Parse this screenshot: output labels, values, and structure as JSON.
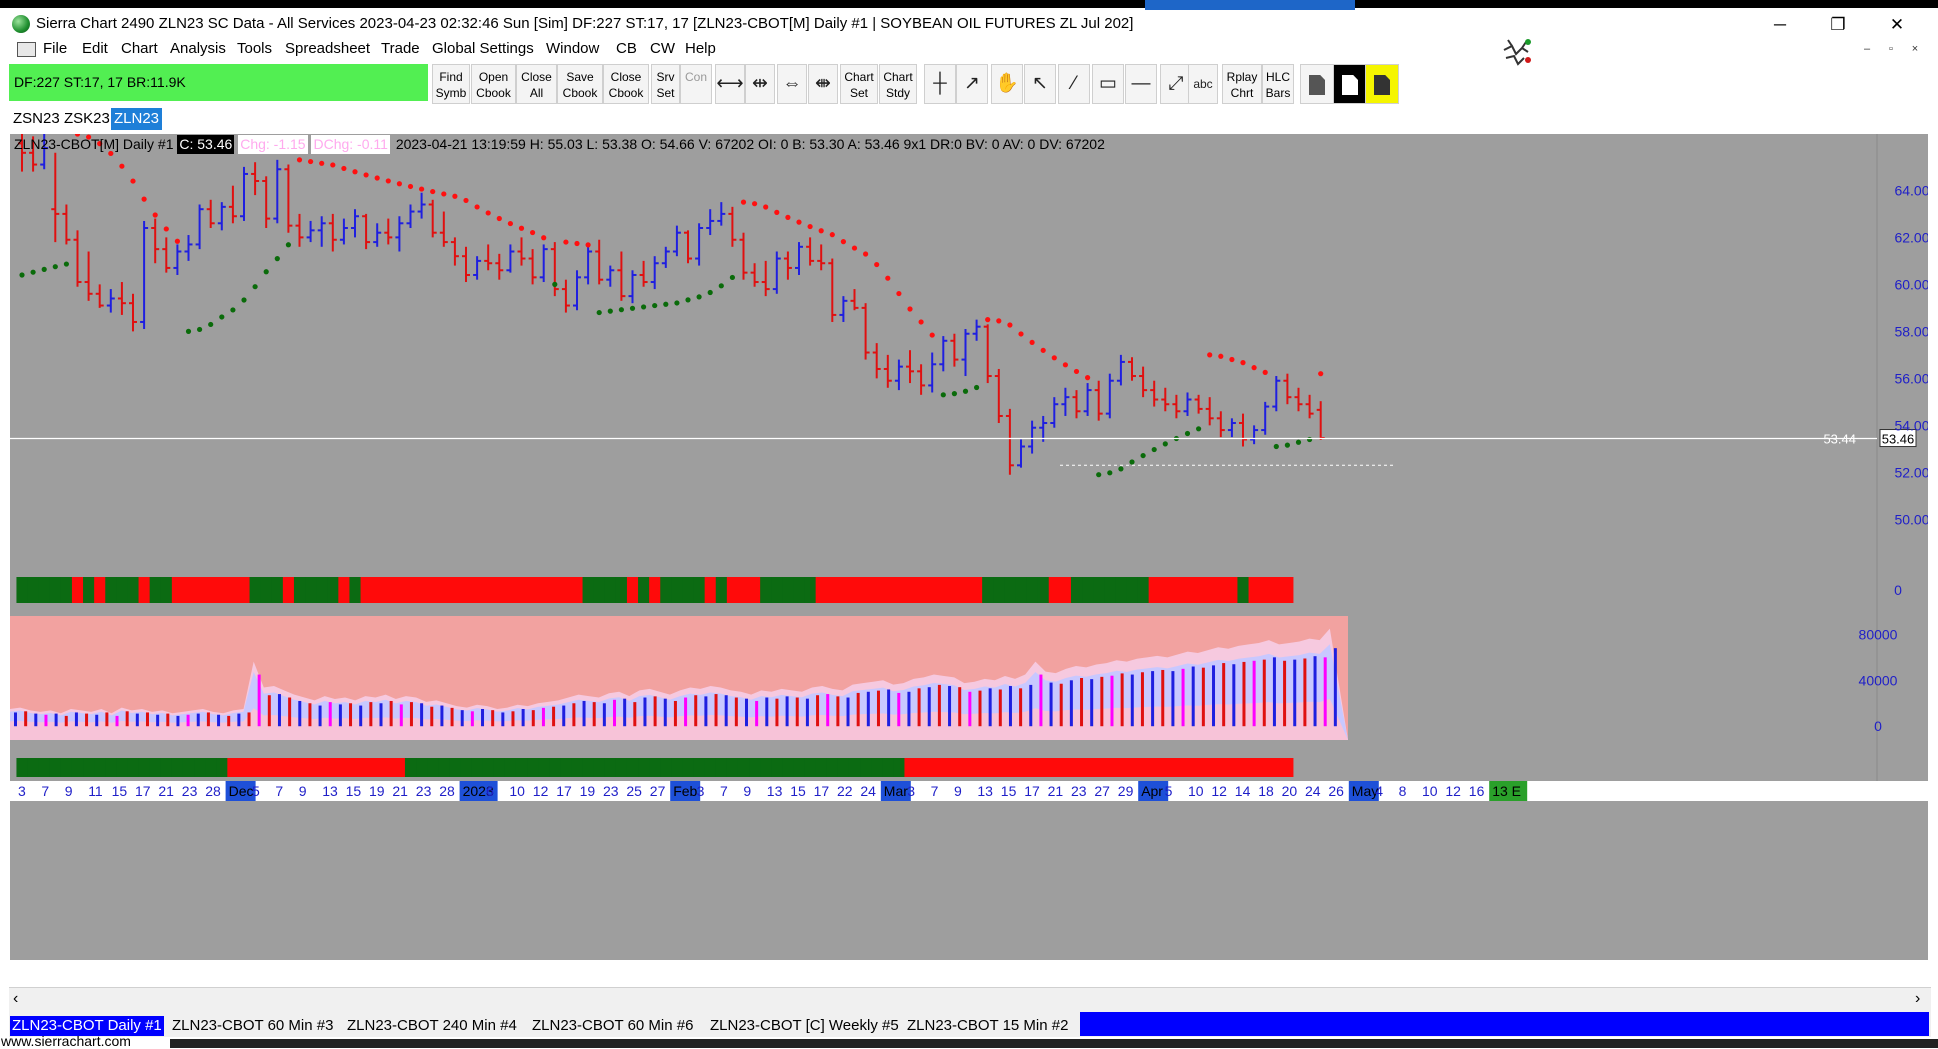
{
  "window": {
    "title": "Sierra Chart 2490 ZLN23  SC Data - All Services 2023-04-23  02:32:46 Sun [Sim]   DF:227  ST:17, 17  [ZLN23-CBOT[M]  Daily  #1 | SOYBEAN OIL FUTURES ZL Jul 202]",
    "minimize": "─",
    "restore": "❐",
    "close": "✕",
    "mdi_minimize": "‒",
    "mdi_restore": "▫",
    "mdi_close": "×"
  },
  "menu": [
    "File",
    "Edit",
    "Chart",
    "Analysis",
    "Tools",
    "Spreadsheet",
    "Trade",
    "Global Settings",
    "Window",
    "CB",
    "CW",
    "Help"
  ],
  "status_box": "DF:227  ST:17, 17  BR:11.9K",
  "toolbar": {
    "text_buttons": [
      {
        "line1": "Find",
        "line2": "Symb"
      },
      {
        "line1": "Open",
        "line2": "Cbook"
      },
      {
        "line1": "Close",
        "line2": "All"
      },
      {
        "line1": "Save",
        "line2": "Cbook"
      },
      {
        "line1": "Close",
        "line2": "Cbook"
      },
      {
        "line1": "Srv",
        "line2": "Set"
      },
      {
        "line1": "Con",
        "line2": ""
      }
    ],
    "chart_buttons": [
      {
        "line1": "Chart",
        "line2": "Set"
      },
      {
        "line1": "Chart",
        "line2": "Stdy"
      }
    ],
    "replay": {
      "line1": "Rplay",
      "line2": "Chrt"
    },
    "hlc": {
      "line1": "HLC",
      "line2": "Bars"
    },
    "abc": "abc",
    "glyphs": [
      "⟷",
      "⇹",
      "⇔",
      "⇼",
      "┼",
      "↗",
      "✋",
      "↖",
      "⁄",
      "▭",
      "—",
      "⤢"
    ]
  },
  "symbol_tabs": [
    "ZSN23",
    "ZSK23",
    "ZLN23"
  ],
  "active_symbol_tab": 2,
  "info": {
    "symbol": "ZLN23-CBOT[M]  Daily  #1",
    "close": "C: 53.46",
    "chg": "Chg: -1.15",
    "dchg": "DChg: -0.11",
    "details": "2023-04-21 13:19:59 H: 55.03  L: 53.38  O: 54.66  V: 67202  OI: 0  B: 53.30  A: 53.46  9x1  DR:0  BV: 0  AV: 0  DV: 67202"
  },
  "price_labels": {
    "line": "53.44",
    "last": "53.46"
  },
  "colors": {
    "chart_bg": "#9e9e9e",
    "up_bar": "#1f1fe0",
    "down_bar": "#e01010",
    "psar_down": "#ff1010",
    "psar_up": "#0a6b0a",
    "psar_neutral": "#7d7d7d",
    "band_green": "#0b6b12",
    "band_red": "#ff0a0a",
    "vol_bg": "#f2a2a0",
    "vol_base": "#f7c3d8",
    "vol_band": "#c8c8ff",
    "axis_text": "#1f1fc8",
    "date_highlight": "#1e50d8"
  },
  "chart_data": {
    "type": "candlestick",
    "title": "ZLN23-CBOT[M] Daily",
    "y_axis_labels": [
      "64.00",
      "62.00",
      "60.00",
      "58.00",
      "56.00",
      "54.00",
      "52.00",
      "50.00"
    ],
    "ylim": [
      48.1,
      66.4
    ],
    "x_axis_labels": [
      "3",
      "7",
      "9",
      "11",
      "15",
      "17",
      "21",
      "23",
      "28",
      "Dec",
      "5",
      "7",
      "9",
      "13",
      "15",
      "19",
      "21",
      "23",
      "28",
      "2023",
      "6",
      "10",
      "12",
      "17",
      "19",
      "23",
      "25",
      "27",
      "Feb",
      "3",
      "7",
      "9",
      "13",
      "15",
      "17",
      "22",
      "24",
      "Mar",
      "3",
      "7",
      "9",
      "13",
      "15",
      "17",
      "21",
      "23",
      "27",
      "29",
      "Apr",
      "5",
      "10",
      "12",
      "14",
      "18",
      "20",
      "24",
      "26",
      "May",
      "4",
      "8",
      "10",
      "12",
      "16",
      "13 E"
    ],
    "highlighted_x_labels": [
      "Dec",
      "2023",
      "Feb",
      "Mar",
      "Apr",
      "May"
    ],
    "last_x_label": "13 E",
    "bars": [
      {
        "o": 66.0,
        "h": 66.4,
        "l": 64.8,
        "c": 65.6
      },
      {
        "o": 65.6,
        "h": 66.3,
        "l": 64.8,
        "c": 65.1
      },
      {
        "o": 65.1,
        "h": 66.4,
        "l": 64.9,
        "c": 65.8
      },
      {
        "o": 63.2,
        "h": 65.6,
        "l": 61.8,
        "c": 63.0
      },
      {
        "o": 63.0,
        "h": 63.4,
        "l": 61.7,
        "c": 61.9
      },
      {
        "o": 61.9,
        "h": 62.3,
        "l": 59.9,
        "c": 60.1
      },
      {
        "o": 60.1,
        "h": 61.4,
        "l": 59.3,
        "c": 59.6
      },
      {
        "o": 59.6,
        "h": 60.0,
        "l": 59.0,
        "c": 59.1
      },
      {
        "o": 59.1,
        "h": 59.8,
        "l": 58.8,
        "c": 59.4
      },
      {
        "o": 59.4,
        "h": 60.1,
        "l": 58.7,
        "c": 59.2
      },
      {
        "o": 59.2,
        "h": 59.6,
        "l": 58.0,
        "c": 58.4
      },
      {
        "o": 58.4,
        "h": 62.7,
        "l": 58.1,
        "c": 62.4
      },
      {
        "o": 62.4,
        "h": 62.8,
        "l": 60.9,
        "c": 61.5
      },
      {
        "o": 61.5,
        "h": 62.0,
        "l": 60.5,
        "c": 60.7
      },
      {
        "o": 60.7,
        "h": 61.7,
        "l": 60.4,
        "c": 61.4
      },
      {
        "o": 61.4,
        "h": 62.1,
        "l": 61.0,
        "c": 61.7
      },
      {
        "o": 61.7,
        "h": 63.4,
        "l": 61.5,
        "c": 63.2
      },
      {
        "o": 63.2,
        "h": 63.6,
        "l": 62.4,
        "c": 62.6
      },
      {
        "o": 62.6,
        "h": 63.5,
        "l": 62.3,
        "c": 63.3
      },
      {
        "o": 63.3,
        "h": 64.2,
        "l": 62.6,
        "c": 62.9
      },
      {
        "o": 62.9,
        "h": 65.0,
        "l": 62.7,
        "c": 64.7
      },
      {
        "o": 64.7,
        "h": 65.2,
        "l": 63.8,
        "c": 64.4
      },
      {
        "o": 64.4,
        "h": 64.6,
        "l": 62.4,
        "c": 62.8
      },
      {
        "o": 62.8,
        "h": 65.3,
        "l": 62.6,
        "c": 64.9
      },
      {
        "o": 64.9,
        "h": 65.1,
        "l": 62.2,
        "c": 62.5
      },
      {
        "o": 62.5,
        "h": 63.0,
        "l": 61.6,
        "c": 62.0
      },
      {
        "o": 62.0,
        "h": 62.7,
        "l": 61.8,
        "c": 62.3
      },
      {
        "o": 62.3,
        "h": 62.9,
        "l": 61.6,
        "c": 62.6
      },
      {
        "o": 62.6,
        "h": 63.0,
        "l": 61.4,
        "c": 61.9
      },
      {
        "o": 61.9,
        "h": 62.8,
        "l": 61.7,
        "c": 62.4
      },
      {
        "o": 62.4,
        "h": 63.2,
        "l": 62.0,
        "c": 62.9
      },
      {
        "o": 62.9,
        "h": 63.0,
        "l": 61.5,
        "c": 61.8
      },
      {
        "o": 61.8,
        "h": 62.6,
        "l": 61.6,
        "c": 62.2
      },
      {
        "o": 62.2,
        "h": 62.8,
        "l": 61.7,
        "c": 62.0
      },
      {
        "o": 62.0,
        "h": 62.9,
        "l": 61.4,
        "c": 62.6
      },
      {
        "o": 62.6,
        "h": 63.4,
        "l": 62.4,
        "c": 63.1
      },
      {
        "o": 63.1,
        "h": 63.9,
        "l": 62.8,
        "c": 63.4
      },
      {
        "o": 63.4,
        "h": 63.6,
        "l": 62.0,
        "c": 62.2
      },
      {
        "o": 62.2,
        "h": 63.1,
        "l": 61.6,
        "c": 61.8
      },
      {
        "o": 61.8,
        "h": 62.0,
        "l": 60.8,
        "c": 61.2
      },
      {
        "o": 61.2,
        "h": 61.6,
        "l": 60.1,
        "c": 60.4
      },
      {
        "o": 60.4,
        "h": 61.2,
        "l": 60.2,
        "c": 61.0
      },
      {
        "o": 61.0,
        "h": 61.7,
        "l": 60.6,
        "c": 60.9
      },
      {
        "o": 60.9,
        "h": 61.3,
        "l": 60.2,
        "c": 60.6
      },
      {
        "o": 60.6,
        "h": 61.7,
        "l": 60.5,
        "c": 61.4
      },
      {
        "o": 61.4,
        "h": 62.0,
        "l": 60.8,
        "c": 61.1
      },
      {
        "o": 61.1,
        "h": 61.5,
        "l": 60.0,
        "c": 60.3
      },
      {
        "o": 60.3,
        "h": 61.7,
        "l": 60.1,
        "c": 61.5
      },
      {
        "o": 61.5,
        "h": 61.8,
        "l": 59.5,
        "c": 59.8
      },
      {
        "o": 59.8,
        "h": 60.2,
        "l": 58.8,
        "c": 59.1
      },
      {
        "o": 59.1,
        "h": 60.6,
        "l": 58.9,
        "c": 60.3
      },
      {
        "o": 60.3,
        "h": 61.6,
        "l": 60.0,
        "c": 61.4
      },
      {
        "o": 61.4,
        "h": 61.9,
        "l": 60.0,
        "c": 60.2
      },
      {
        "o": 60.2,
        "h": 60.8,
        "l": 59.9,
        "c": 60.6
      },
      {
        "o": 60.6,
        "h": 61.4,
        "l": 59.3,
        "c": 59.5
      },
      {
        "o": 59.5,
        "h": 60.6,
        "l": 59.2,
        "c": 60.4
      },
      {
        "o": 60.4,
        "h": 61.0,
        "l": 59.9,
        "c": 60.1
      },
      {
        "o": 60.1,
        "h": 61.2,
        "l": 59.8,
        "c": 60.9
      },
      {
        "o": 60.9,
        "h": 61.6,
        "l": 60.7,
        "c": 61.4
      },
      {
        "o": 61.4,
        "h": 62.5,
        "l": 61.2,
        "c": 62.2
      },
      {
        "o": 62.2,
        "h": 62.3,
        "l": 60.9,
        "c": 61.1
      },
      {
        "o": 61.1,
        "h": 62.6,
        "l": 60.8,
        "c": 62.4
      },
      {
        "o": 62.4,
        "h": 63.2,
        "l": 62.1,
        "c": 62.7
      },
      {
        "o": 62.7,
        "h": 63.5,
        "l": 62.5,
        "c": 63.0
      },
      {
        "o": 63.0,
        "h": 63.3,
        "l": 61.6,
        "c": 61.9
      },
      {
        "o": 61.9,
        "h": 62.2,
        "l": 60.2,
        "c": 60.5
      },
      {
        "o": 60.5,
        "h": 60.9,
        "l": 59.9,
        "c": 60.1
      },
      {
        "o": 60.1,
        "h": 61.0,
        "l": 59.5,
        "c": 59.8
      },
      {
        "o": 59.8,
        "h": 61.4,
        "l": 59.6,
        "c": 61.1
      },
      {
        "o": 61.1,
        "h": 61.4,
        "l": 60.2,
        "c": 60.7
      },
      {
        "o": 60.7,
        "h": 61.8,
        "l": 60.4,
        "c": 61.6
      },
      {
        "o": 61.6,
        "h": 62.0,
        "l": 60.8,
        "c": 61.0
      },
      {
        "o": 61.0,
        "h": 61.7,
        "l": 60.6,
        "c": 60.9
      },
      {
        "o": 60.9,
        "h": 61.1,
        "l": 58.4,
        "c": 58.7
      },
      {
        "o": 58.7,
        "h": 59.5,
        "l": 58.4,
        "c": 59.3
      },
      {
        "o": 59.3,
        "h": 59.8,
        "l": 58.9,
        "c": 59.0
      },
      {
        "o": 59.0,
        "h": 59.2,
        "l": 56.8,
        "c": 57.1
      },
      {
        "o": 57.1,
        "h": 57.5,
        "l": 56.0,
        "c": 56.4
      },
      {
        "o": 56.4,
        "h": 57.0,
        "l": 55.6,
        "c": 55.9
      },
      {
        "o": 55.9,
        "h": 56.8,
        "l": 55.5,
        "c": 56.5
      },
      {
        "o": 56.5,
        "h": 57.2,
        "l": 55.8,
        "c": 56.3
      },
      {
        "o": 56.3,
        "h": 56.6,
        "l": 55.3,
        "c": 55.7
      },
      {
        "o": 55.7,
        "h": 57.1,
        "l": 55.4,
        "c": 56.6
      },
      {
        "o": 56.6,
        "h": 57.8,
        "l": 56.3,
        "c": 57.6
      },
      {
        "o": 57.6,
        "h": 57.9,
        "l": 56.5,
        "c": 56.8
      },
      {
        "o": 56.8,
        "h": 58.1,
        "l": 56.1,
        "c": 57.9
      },
      {
        "o": 57.9,
        "h": 58.5,
        "l": 57.6,
        "c": 58.2
      },
      {
        "o": 58.2,
        "h": 58.3,
        "l": 55.8,
        "c": 56.1
      },
      {
        "o": 56.1,
        "h": 56.4,
        "l": 54.1,
        "c": 54.4
      },
      {
        "o": 54.4,
        "h": 54.7,
        "l": 51.9,
        "c": 52.3
      },
      {
        "o": 52.3,
        "h": 53.4,
        "l": 52.2,
        "c": 53.1
      },
      {
        "o": 53.1,
        "h": 54.2,
        "l": 52.8,
        "c": 53.9
      },
      {
        "o": 53.9,
        "h": 54.4,
        "l": 53.3,
        "c": 54.1
      },
      {
        "o": 54.1,
        "h": 55.2,
        "l": 53.9,
        "c": 54.9
      },
      {
        "o": 54.9,
        "h": 55.6,
        "l": 54.4,
        "c": 55.2
      },
      {
        "o": 55.2,
        "h": 55.5,
        "l": 54.3,
        "c": 54.6
      },
      {
        "o": 54.6,
        "h": 55.8,
        "l": 54.4,
        "c": 55.5
      },
      {
        "o": 55.5,
        "h": 55.9,
        "l": 54.2,
        "c": 54.5
      },
      {
        "o": 54.5,
        "h": 56.2,
        "l": 54.3,
        "c": 55.9
      },
      {
        "o": 55.9,
        "h": 57.0,
        "l": 55.7,
        "c": 56.7
      },
      {
        "o": 56.7,
        "h": 56.9,
        "l": 55.9,
        "c": 56.1
      },
      {
        "o": 56.1,
        "h": 56.5,
        "l": 55.2,
        "c": 55.5
      },
      {
        "o": 55.5,
        "h": 55.9,
        "l": 54.8,
        "c": 55.1
      },
      {
        "o": 55.1,
        "h": 55.6,
        "l": 54.6,
        "c": 54.9
      },
      {
        "o": 54.9,
        "h": 55.3,
        "l": 54.3,
        "c": 54.6
      },
      {
        "o": 54.6,
        "h": 55.4,
        "l": 54.4,
        "c": 55.1
      },
      {
        "o": 55.1,
        "h": 55.3,
        "l": 54.5,
        "c": 54.7
      },
      {
        "o": 54.7,
        "h": 55.2,
        "l": 54.0,
        "c": 54.3
      },
      {
        "o": 54.3,
        "h": 54.6,
        "l": 53.5,
        "c": 53.8
      },
      {
        "o": 53.8,
        "h": 54.3,
        "l": 53.5,
        "c": 54.1
      },
      {
        "o": 54.1,
        "h": 54.5,
        "l": 53.1,
        "c": 53.4
      },
      {
        "o": 53.4,
        "h": 54.0,
        "l": 53.2,
        "c": 53.8
      },
      {
        "o": 53.8,
        "h": 55.0,
        "l": 53.6,
        "c": 54.8
      },
      {
        "o": 54.8,
        "h": 56.1,
        "l": 54.6,
        "c": 55.9
      },
      {
        "o": 55.9,
        "h": 56.2,
        "l": 54.9,
        "c": 55.2
      },
      {
        "o": 55.2,
        "h": 55.6,
        "l": 54.6,
        "c": 54.9
      },
      {
        "o": 54.9,
        "h": 55.3,
        "l": 54.3,
        "c": 54.5
      },
      {
        "o": 54.66,
        "h": 55.03,
        "l": 53.38,
        "c": 53.46
      }
    ],
    "psar": {
      "start": 0,
      "end": 116,
      "values_start": 60.4,
      "notes": "stop-and-reverse dots"
    },
    "band_top": [
      "g",
      "g",
      "g",
      "g",
      "g",
      "r",
      "g",
      "r",
      "g",
      "g",
      "g",
      "r",
      "g",
      "g",
      "r",
      "r",
      "r",
      "r",
      "r",
      "r",
      "r",
      "g",
      "g",
      "g",
      "r",
      "g",
      "g",
      "g",
      "g",
      "r",
      "g",
      "r",
      "r",
      "r",
      "r",
      "r",
      "r",
      "r",
      "r",
      "r",
      "r",
      "r",
      "r",
      "r",
      "r",
      "r",
      "r",
      "r",
      "r",
      "r",
      "r",
      "g",
      "g",
      "g",
      "g",
      "r",
      "g",
      "r",
      "g",
      "g",
      "g",
      "g",
      "r",
      "g",
      "r",
      "r",
      "r",
      "g",
      "g",
      "g",
      "g",
      "g",
      "r",
      "r",
      "r",
      "r",
      "r",
      "r",
      "r",
      "r",
      "r",
      "r",
      "r",
      "r",
      "r",
      "r",
      "r",
      "g",
      "g",
      "g",
      "g",
      "g",
      "g",
      "r",
      "r",
      "g",
      "g",
      "g",
      "g",
      "g",
      "g",
      "g",
      "r",
      "r",
      "r",
      "r",
      "r",
      "r",
      "r",
      "r",
      "g",
      "r",
      "r",
      "r",
      "r"
    ],
    "band_bottom": [
      "g",
      "g",
      "g",
      "g",
      "g",
      "g",
      "g",
      "g",
      "g",
      "g",
      "g",
      "g",
      "g",
      "g",
      "g",
      "g",
      "g",
      "g",
      "g",
      "r",
      "r",
      "r",
      "r",
      "r",
      "r",
      "r",
      "r",
      "r",
      "r",
      "r",
      "r",
      "r",
      "r",
      "r",
      "r",
      "g",
      "g",
      "g",
      "g",
      "g",
      "g",
      "g",
      "g",
      "g",
      "g",
      "g",
      "g",
      "g",
      "g",
      "g",
      "g",
      "g",
      "g",
      "g",
      "g",
      "g",
      "g",
      "g",
      "g",
      "g",
      "g",
      "g",
      "g",
      "g",
      "g",
      "g",
      "g",
      "g",
      "g",
      "g",
      "g",
      "g",
      "g",
      "g",
      "g",
      "g",
      "g",
      "g",
      "g",
      "g",
      "r",
      "r",
      "r",
      "r",
      "r",
      "r",
      "r",
      "r",
      "r",
      "r",
      "r",
      "r",
      "r",
      "r",
      "r",
      "r",
      "r",
      "r",
      "r",
      "r",
      "r",
      "r",
      "r",
      "r",
      "r",
      "r",
      "r",
      "r",
      "r",
      "r",
      "r",
      "r",
      "r",
      "r",
      "r"
    ],
    "volume": {
      "y_axis_labels": [
        "80000",
        "40000",
        "0"
      ],
      "ylim": [
        -12000,
        96000
      ],
      "values": [
        12000,
        13000,
        11000,
        10000,
        11000,
        9000,
        12000,
        11000,
        10000,
        12000,
        9000,
        13000,
        11000,
        12000,
        10000,
        11000,
        9000,
        10000,
        11000,
        12000,
        10000,
        9000,
        11000,
        12000,
        45000,
        27000,
        28000,
        25000,
        22000,
        20000,
        18000,
        21000,
        19000,
        20000,
        18000,
        21000,
        20000,
        22000,
        19000,
        21000,
        20000,
        17000,
        18000,
        16000,
        14000,
        13000,
        15000,
        14000,
        12000,
        13000,
        15000,
        14000,
        16000,
        17000,
        18000,
        20000,
        22000,
        21000,
        20000,
        23000,
        24000,
        21000,
        25000,
        26000,
        24000,
        22000,
        25000,
        27000,
        26000,
        28000,
        27000,
        25000,
        24000,
        22000,
        25000,
        24000,
        26000,
        25000,
        24000,
        27000,
        28000,
        26000,
        25000,
        29000,
        30000,
        31000,
        32000,
        29000,
        30000,
        33000,
        34000,
        36000,
        35000,
        34000,
        30000,
        31000,
        33000,
        32000,
        35000,
        33000,
        36000,
        45000,
        38000,
        37000,
        40000,
        42000,
        41000,
        43000,
        44000,
        46000,
        45000,
        47000,
        48000,
        49000,
        48000,
        50000,
        52000,
        51000,
        53000,
        55000,
        54000,
        56000,
        57000,
        58000,
        60000,
        57000,
        58000,
        59000,
        61000,
        60000,
        68000
      ],
      "colors_note": "blue up-volume, red down-volume, magenta average"
    }
  },
  "bottom_tabs": [
    {
      "label": "ZLN23-CBOT  Daily  #1",
      "active": true
    },
    {
      "label": "ZLN23-CBOT  60 Min  #3",
      "active": false
    },
    {
      "label": "ZLN23-CBOT  240 Min  #4",
      "active": false
    },
    {
      "label": "ZLN23-CBOT  60 Min  #6",
      "active": false
    },
    {
      "label": "ZLN23-CBOT [C]  Weekly  #5",
      "active": false
    },
    {
      "label": "ZLN23-CBOT  15 Min  #2",
      "active": false
    }
  ],
  "footer": "www.sierrachart.com"
}
